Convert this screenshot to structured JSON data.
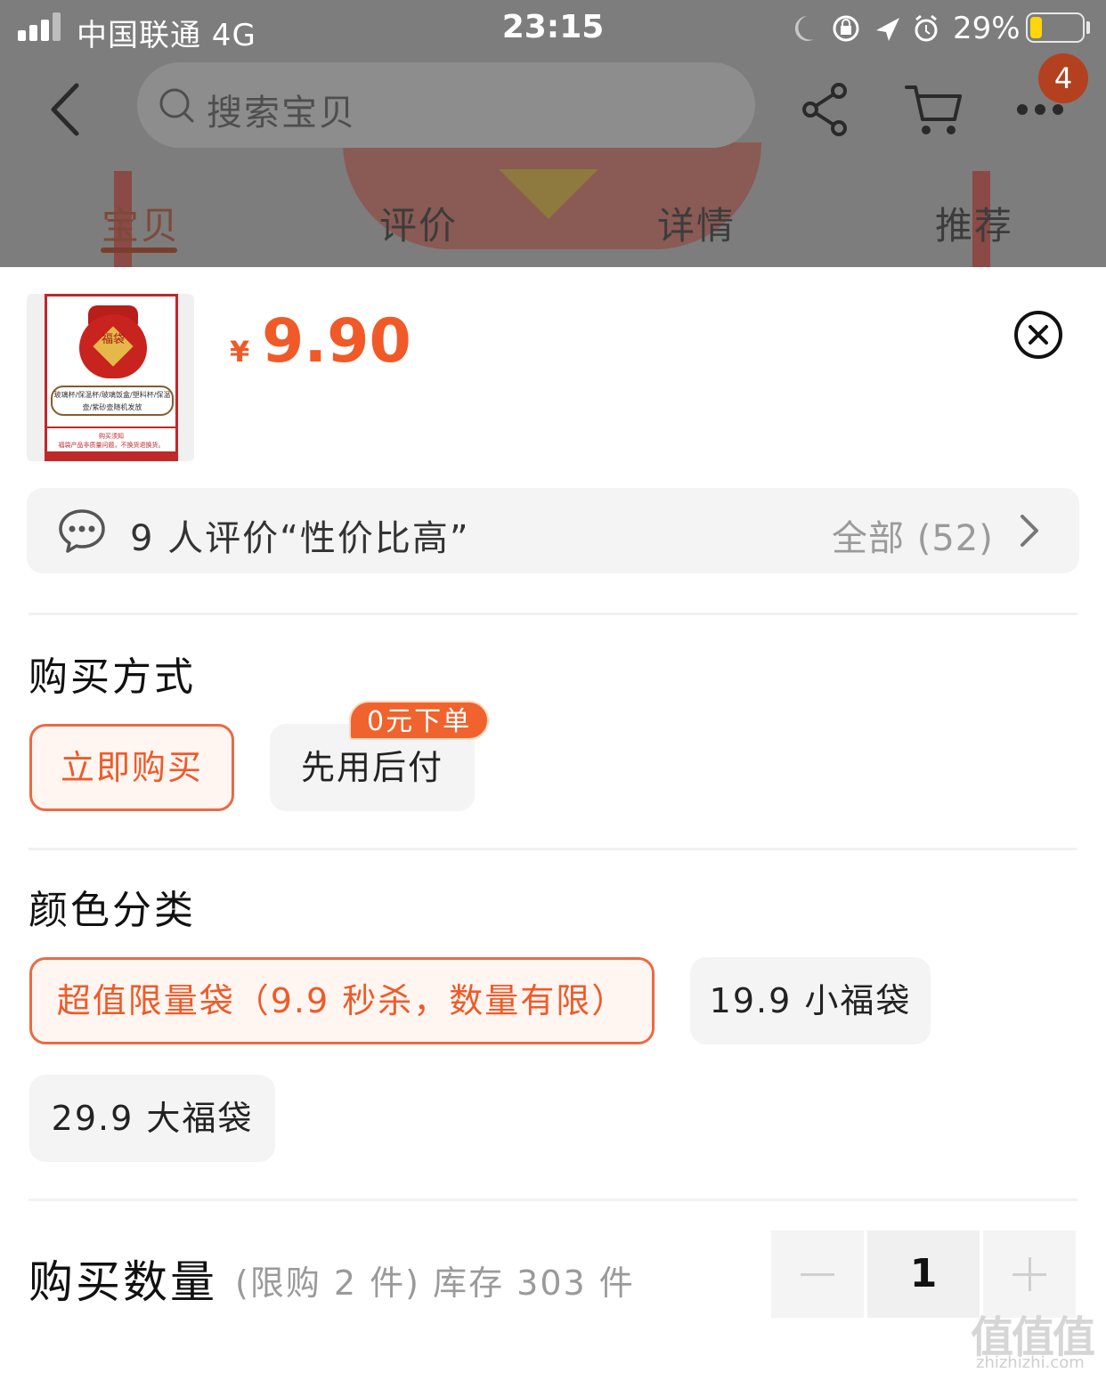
{
  "status_bar": {
    "carrier": "中国联通  4G",
    "time": "23:15",
    "battery_percent": "29%",
    "icons": [
      "signal-icon",
      "moon-icon",
      "orientation-lock-icon",
      "location-arrow-icon",
      "alarm-icon",
      "battery-icon"
    ],
    "battery_level": 0.29,
    "battery_color": "#ffd60a"
  },
  "header": {
    "search_placeholder": "搜索宝贝",
    "cart_badge": "4",
    "icons": [
      "back-icon",
      "search-icon",
      "share-icon",
      "cart-icon",
      "more-icon"
    ]
  },
  "tabs": [
    {
      "label": "宝贝",
      "active": true
    },
    {
      "label": "评价",
      "active": false
    },
    {
      "label": "详情",
      "active": false
    },
    {
      "label": "推荐",
      "active": false
    }
  ],
  "product": {
    "thumbnail_caption": "玻璃杯/保温杯/玻璃饭盒/塑料杯/保温壶/紫砂壶随机发放",
    "thumbnail_bag_text": "福袋",
    "thumbnail_footer_title": "购买须知",
    "thumbnail_footer_text": "福袋产品非质量问题，不换货退换货。",
    "price_symbol": "¥",
    "price": "9.90"
  },
  "review": {
    "summary": "9 人评价“性价比高”",
    "all_label": "全部 (52)"
  },
  "purchase_method": {
    "title": "购买方式",
    "options": [
      {
        "label": "立即购买",
        "selected": true
      },
      {
        "label": "先用后付",
        "selected": false,
        "tag": "0元下单"
      }
    ]
  },
  "color_category": {
    "title": "颜色分类",
    "options": [
      {
        "label": "超值限量袋（9.9 秒杀，数量有限）",
        "selected": true
      },
      {
        "label": "19.9 小福袋",
        "selected": false
      },
      {
        "label": "29.9 大福袋",
        "selected": false
      }
    ]
  },
  "quantity": {
    "title": "购买数量",
    "limit_text": "(限购 2 件) 库存 303 件",
    "value": "1"
  },
  "watermark": {
    "chars": "值值值",
    "url": "zhizhizhi.com"
  },
  "colors": {
    "accent": "#f05a28",
    "selected_border": "#ea6a44",
    "option_bg": "#f4f4f4",
    "overlay": "#7d7d7d"
  }
}
